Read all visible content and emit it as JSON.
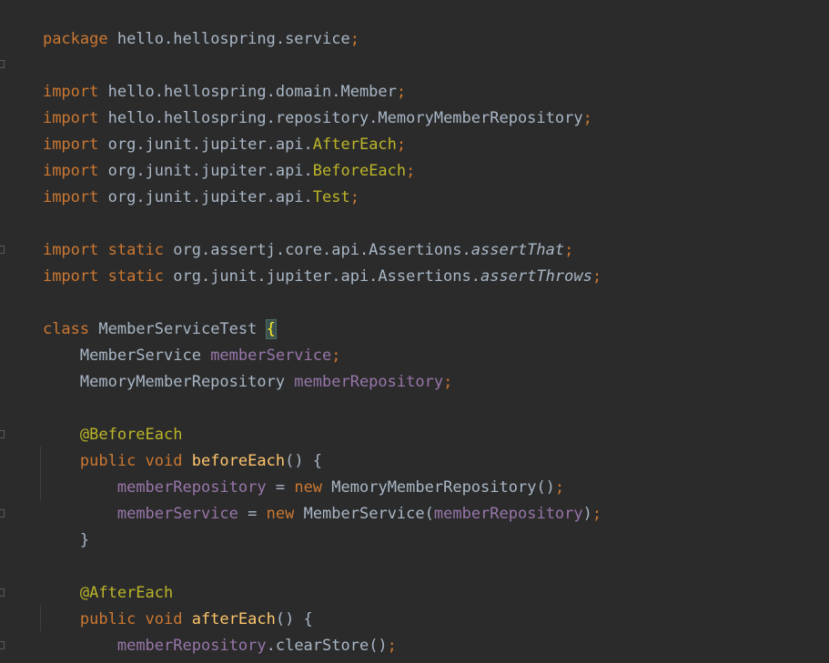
{
  "editor": {
    "theme_colors": {
      "background": "#2b2b2b",
      "keyword": "#cc7832",
      "plain": "#a9b7c6",
      "field": "#9876aa",
      "annotation": "#bbb529",
      "method": "#ffc66d"
    },
    "line1": {
      "t1": "package",
      "t2": " hello.hellospring.service",
      "t3": ";"
    },
    "line2": {
      "t1": "import",
      "t2": " hello.hellospring.domain.Member",
      "t3": ";"
    },
    "line3": {
      "t1": "import",
      "t2": " hello.hellospring.repository.MemoryMemberRepository",
      "t3": ";"
    },
    "line4": {
      "t1": "import",
      "t2": " org.junit.jupiter.api.",
      "t3": "AfterEach",
      "t4": ";"
    },
    "line5": {
      "t1": "import",
      "t2": " org.junit.jupiter.api.",
      "t3": "BeforeEach",
      "t4": ";"
    },
    "line6": {
      "t1": "import",
      "t2": " org.junit.jupiter.api.",
      "t3": "Test",
      "t4": ";"
    },
    "line7": {
      "t1": "import static",
      "t2": " org.assertj.core.api.Assertions.",
      "t3": "assertThat",
      "t4": ";"
    },
    "line8": {
      "t1": "import static",
      "t2": " org.junit.jupiter.api.Assertions.",
      "t3": "assertThrows",
      "t4": ";"
    },
    "line9": {
      "t1": "class",
      "t2": " MemberServiceTest ",
      "t3": "{"
    },
    "line10": {
      "t1": "    MemberService ",
      "t2": "memberService",
      "t3": ";"
    },
    "line11": {
      "t1": "    MemoryMemberRepository ",
      "t2": "memberRepository",
      "t3": ";"
    },
    "line12": {
      "t1": "    @BeforeEach"
    },
    "line13": {
      "t1": "    public void ",
      "t2": "beforeEach",
      "t3": "() {"
    },
    "line14": {
      "t1": "        ",
      "t2": "memberRepository",
      "t3": " = ",
      "t4": "new",
      "t5": " MemoryMemberRepository()",
      "t6": ";"
    },
    "line15": {
      "t1": "        ",
      "t2": "memberService",
      "t3": " = ",
      "t4": "new",
      "t5": " MemberService(",
      "t6": "memberRepository",
      "t7": ")",
      "t8": ";"
    },
    "line16": {
      "t1": "    }"
    },
    "line17": {
      "t1": "    @AfterEach"
    },
    "line18": {
      "t1": "    public void ",
      "t2": "afterEach",
      "t3": "() {"
    },
    "line19": {
      "t1": "        ",
      "t2": "memberRepository",
      "t3": ".clearStore()",
      "t4": ";"
    },
    "line20": {
      "t1": "    }"
    }
  }
}
